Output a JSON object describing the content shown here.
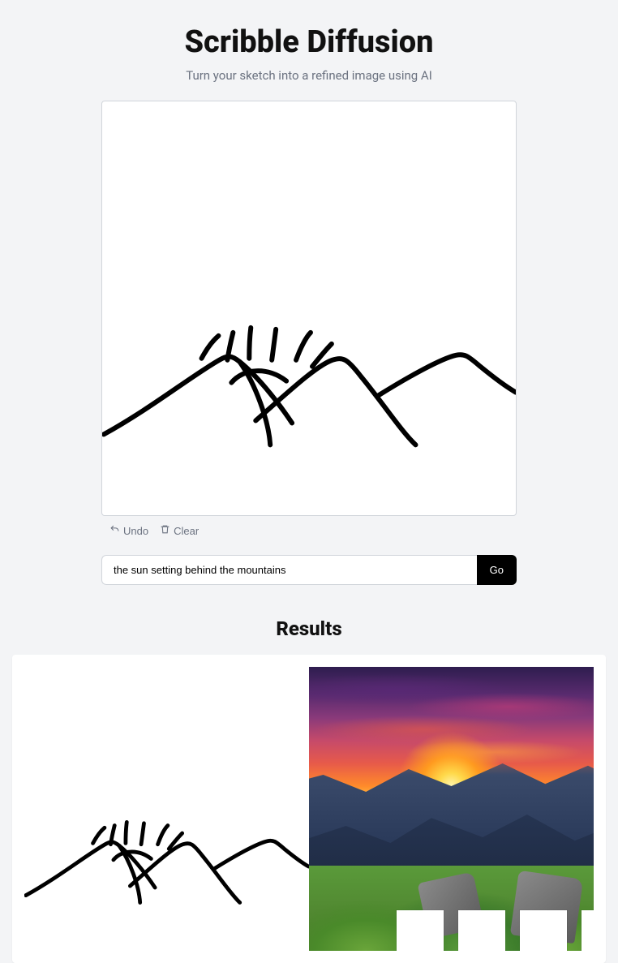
{
  "header": {
    "title": "Scribble Diffusion",
    "subtitle": "Turn your sketch into a refined image using AI"
  },
  "controls": {
    "undo_label": "Undo",
    "clear_label": "Clear"
  },
  "prompt": {
    "value": "the sun setting behind the mountains",
    "go_label": "Go"
  },
  "results": {
    "heading": "Results"
  }
}
